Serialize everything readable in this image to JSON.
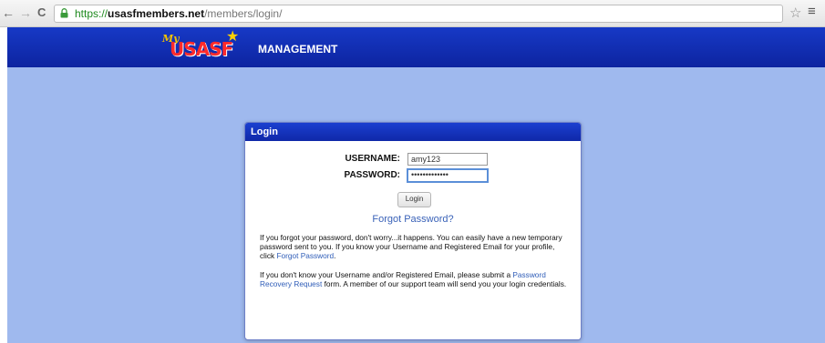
{
  "browser": {
    "url_host": "https://",
    "url_domain": "usasfmembers.net",
    "url_path": "/members/login/",
    "back_glyph": "←",
    "forward_glyph": "→",
    "reload_glyph": "C",
    "star_glyph": "☆",
    "menu_glyph": "≡"
  },
  "header": {
    "logo_my": "My",
    "logo_text": "USASF",
    "logo_stars": "★",
    "section_title": "MANAGEMENT",
    "bar_color": "#1435b8"
  },
  "login": {
    "panel_title": "Login",
    "username_label": "USERNAME:",
    "username_value": "amy123",
    "password_label": "PASSWORD:",
    "password_value": "•••••••••••••",
    "submit_label": "Login",
    "forgot_link": "Forgot Password?",
    "para1_text": "If you forgot your password, don't worry...it happens. You can easily have a new temporary password sent to you. If you know your Username and Registered Email for your profile, click ",
    "para1_link": "Forgot Password",
    "para1_end": ".",
    "para2_text": "If you don't know your Username and/or Registered Email, please submit a ",
    "para2_link": "Password Recovery Request",
    "para2_end": " form. A member of our support team will send you your login credentials."
  },
  "colors": {
    "page_background": "#9fb9ee",
    "link": "#2f5db8"
  }
}
